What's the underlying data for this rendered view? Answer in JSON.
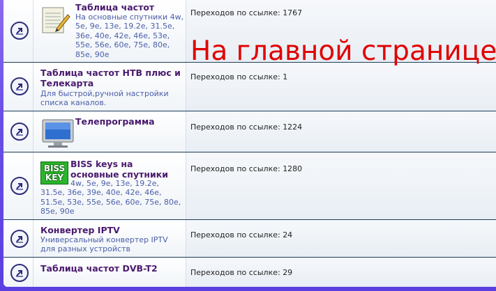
{
  "rows": [
    {
      "title": "Таблица частот",
      "desc": "На основные спутники 4w, 5e, 9e, 13e, 19.2e, 31.5e, 36e, 40e, 42e, 46e, 53e, 55e, 56e, 60e, 75e, 80e, 85e, 90e",
      "stat": "Переходов по ссылке: 1767",
      "icon": "notepad-icon"
    },
    {
      "title": "Таблица частот НТВ плюс и Телекарта",
      "desc": "Для быстрой,ручной настройки списка каналов.",
      "stat": "Переходов по ссылке: 1"
    },
    {
      "title": "Телепрограмма",
      "desc": "",
      "stat": "Переходов по ссылке: 1224",
      "icon": "monitor-icon"
    },
    {
      "title": "BISS keys на основные спутники",
      "desc": "4w, 5e, 9e, 13e, 19.2e, 31.5e, 36e, 39e, 40e, 42e, 46e, 51.5e, 53e, 55e, 56e, 60e, 75e, 80e, 85e, 90e",
      "stat": "Переходов по ссылке: 1280",
      "icon": "biss-key-icon",
      "icon_text_top": "BISS",
      "icon_text_bottom": "KEY"
    },
    {
      "title": "Конвертер IPTV",
      "desc": "Универсальный конвертер IPTV для разных устройств",
      "stat": "Переходов по ссылке: 24"
    },
    {
      "title": "Таблица частот DVB-T2",
      "desc": "",
      "stat": "Переходов по ссылке: 29"
    }
  ],
  "overlay_text": "На главной странице",
  "colors": {
    "title": "#4a1a6e",
    "desc": "#4a5ea8",
    "overlay": "#e00000",
    "frame_bg": "#6a4fe6"
  }
}
